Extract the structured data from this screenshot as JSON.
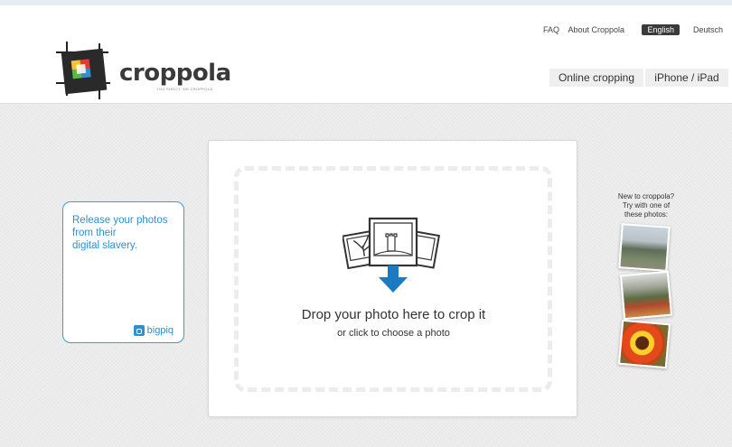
{
  "header": {
    "logo_name": "croppola",
    "tagline": "YOU SHOOT, WE CROPPOLA",
    "links": {
      "faq": "FAQ",
      "about": "About Croppola"
    },
    "languages": {
      "english": "English",
      "deutsch": "Deutsch"
    },
    "tabs": {
      "online": "Online cropping",
      "iphone": "iPhone / iPad"
    }
  },
  "ad": {
    "line1": "Release your photos",
    "line2": "from their",
    "line3": "digital slavery.",
    "brand": "bigpiq"
  },
  "dropzone": {
    "title": "Drop your photo here to crop it",
    "subtitle": "or click to choose a photo",
    "arrow_color": "#1a7bc2"
  },
  "samples": {
    "line1": "New to croppola?",
    "line2": "Try with one of",
    "line3": "these photos:"
  },
  "colors": {
    "accent_blue": "#2f8fd0",
    "dark": "#3a3a3a"
  }
}
